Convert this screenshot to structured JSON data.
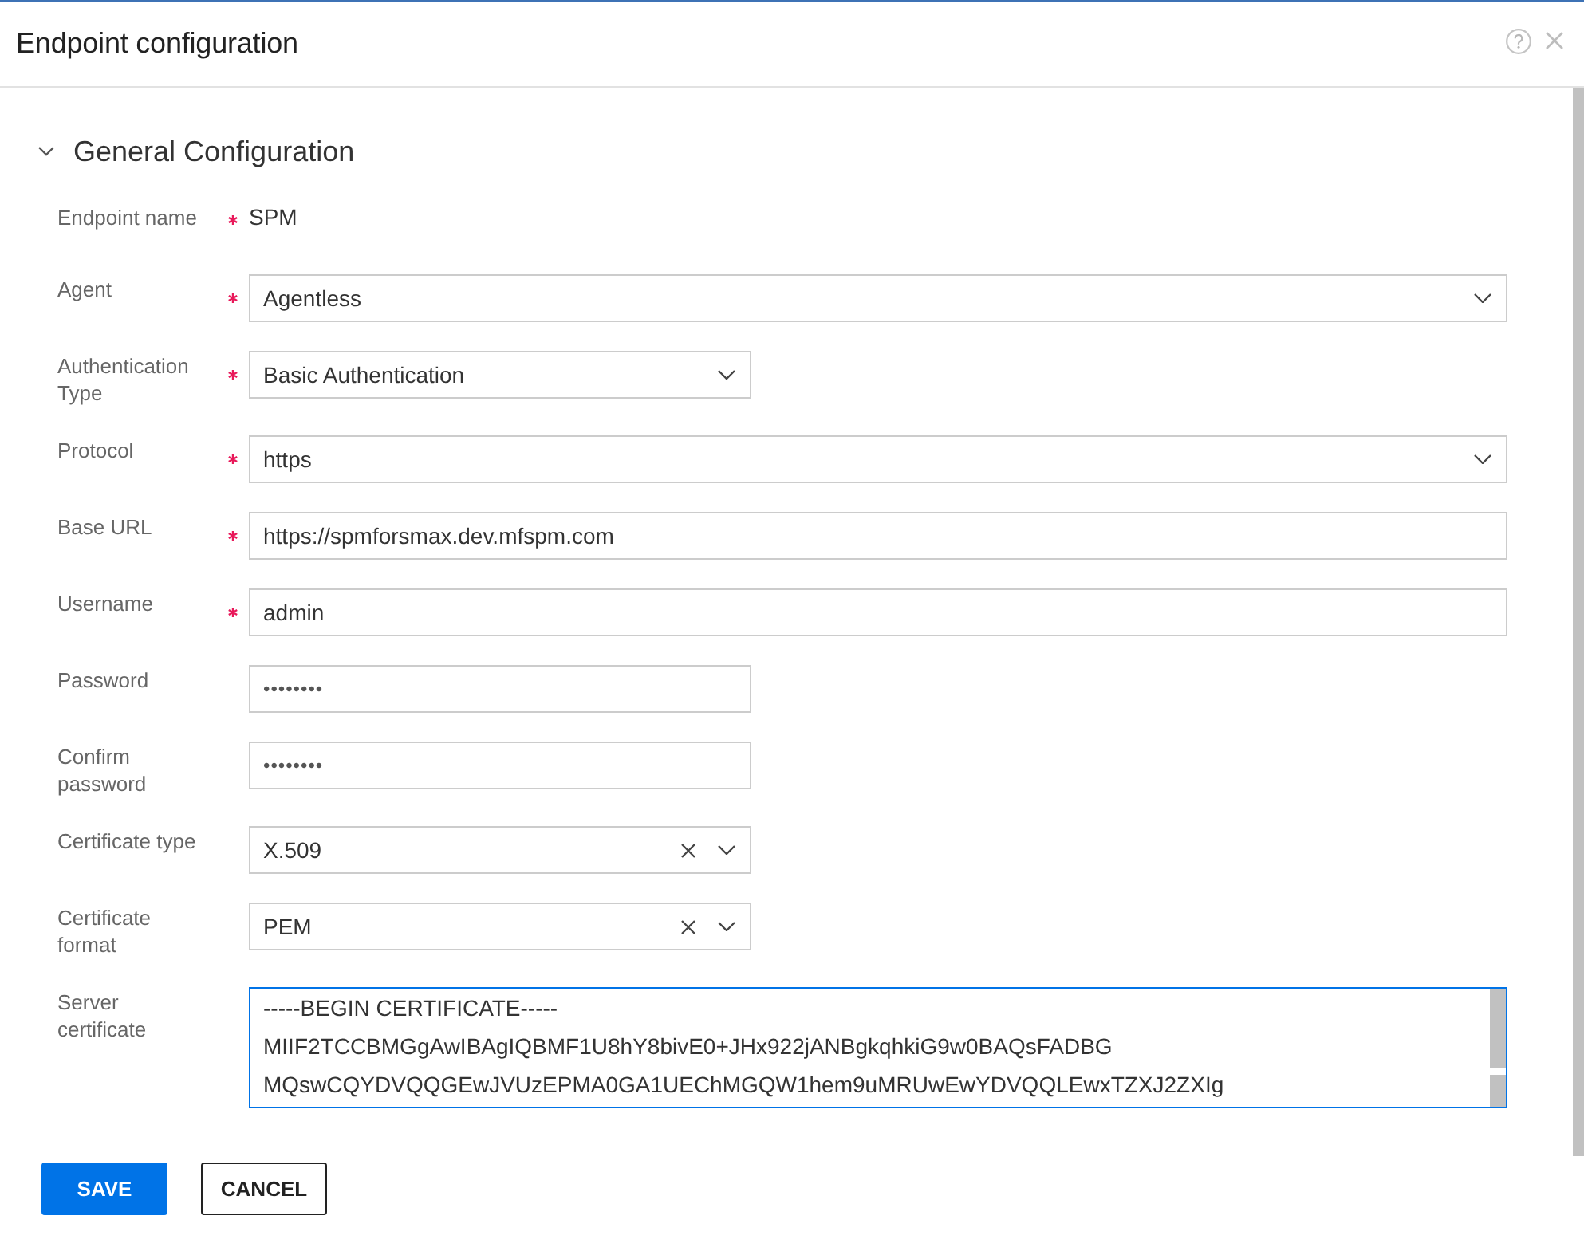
{
  "dialog": {
    "title": "Endpoint configuration"
  },
  "section": {
    "title": "General Configuration",
    "expanded": true
  },
  "fields": [
    {
      "label": "Endpoint name",
      "required": true,
      "kind": "readonly",
      "value": "SPM"
    },
    {
      "label": "Agent",
      "required": true,
      "kind": "select",
      "value": "Agentless",
      "clearable": false,
      "focused": false
    },
    {
      "label": "Authentication Type",
      "required": true,
      "kind": "select",
      "value": "Basic Authentication",
      "clearable": false,
      "focused": false
    },
    {
      "label": "Protocol",
      "required": true,
      "kind": "select",
      "value": "https",
      "clearable": false,
      "focused": false
    },
    {
      "label": "Base URL",
      "required": true,
      "kind": "text",
      "value": "https://spmforsmax.dev.mfspm.com",
      "focused": false
    },
    {
      "label": "Username",
      "required": true,
      "kind": "text",
      "value": "admin",
      "focused": false
    },
    {
      "label": "Password",
      "required": false,
      "kind": "password",
      "value": "••••••••",
      "focused": false
    },
    {
      "label": "Confirm password",
      "required": false,
      "kind": "password",
      "value": "••••••••",
      "focused": false
    },
    {
      "label": "Certificate type",
      "required": false,
      "kind": "select",
      "value": "X.509",
      "clearable": true,
      "focused": false
    },
    {
      "label": "Certificate format",
      "required": false,
      "kind": "select",
      "value": "PEM",
      "clearable": true,
      "focused": false
    },
    {
      "label": "Server certificate",
      "required": false,
      "kind": "textarea",
      "value": "-----BEGIN CERTIFICATE-----\nMIIF2TCCBMGgAwIBAgIQBMF1U8hY8bivE0+JHx922jANBgkqhkiG9w0BAQsFADBG\nMQswCQYDVQQGEwJVUzEPMA0GA1UEChMGQW1hem9uMRUwEwYDVQQLEwxTZXJ2ZXIg",
      "focused": true
    }
  ],
  "buttons": [
    {
      "label": "SAVE",
      "kind": "primary"
    },
    {
      "label": "CANCEL",
      "kind": "secondary"
    }
  ]
}
